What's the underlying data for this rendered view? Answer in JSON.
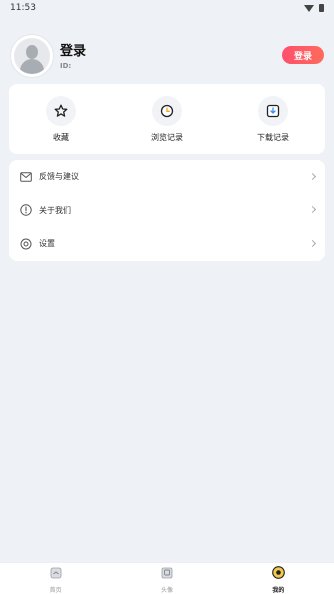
{
  "status_bar": {
    "time": "11:53"
  },
  "profile": {
    "name": "登录",
    "id_label": "ID:",
    "login_button": "登录"
  },
  "quick_actions": [
    {
      "label": "收藏",
      "icon": "star-icon"
    },
    {
      "label": "浏览记录",
      "icon": "clock-icon"
    },
    {
      "label": "下载记录",
      "icon": "download-icon"
    }
  ],
  "menu": [
    {
      "label": "反馈与建议",
      "icon": "mail-icon"
    },
    {
      "label": "关于我们",
      "icon": "info-icon"
    },
    {
      "label": "设置",
      "icon": "gear-icon"
    }
  ],
  "bottom_nav": [
    {
      "label": "首页",
      "icon": "home-icon",
      "active": false
    },
    {
      "label": "头像",
      "icon": "avatar-frame-icon",
      "active": false
    },
    {
      "label": "我的",
      "icon": "profile-icon",
      "active": true
    }
  ],
  "colors": {
    "accent_start": "#ff4f6d",
    "accent_end": "#ff6b5b",
    "background": "#eef1f5"
  }
}
